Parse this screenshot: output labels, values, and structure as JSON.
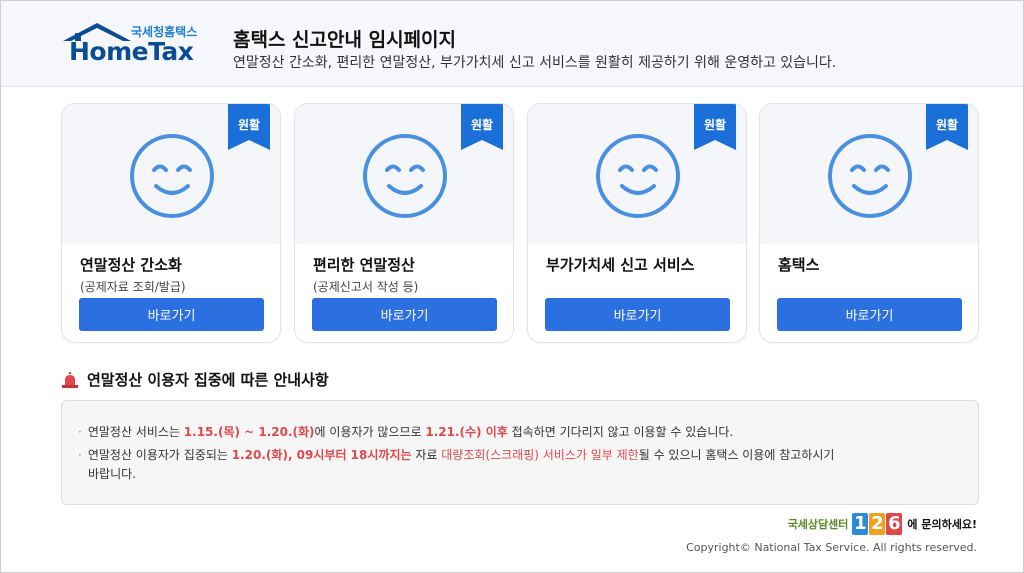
{
  "header": {
    "logo_sub": "국세청홈택스",
    "logo_main": "HomeTax",
    "title": "홈택스 신고안내 임시페이지",
    "subtitle": "연말정산 간소화, 편리한 연말정산, 부가가치세 신고 서비스를 원활히 제공하기 위해 운영하고 있습니다."
  },
  "cards": [
    {
      "status": "원활",
      "title": "연말정산 간소화",
      "desc": "(공제자료 조회/발급)",
      "button": "바로가기"
    },
    {
      "status": "원활",
      "title": "편리한 연말정산",
      "desc": "(공제신고서 작성 등)",
      "button": "바로가기"
    },
    {
      "status": "원활",
      "title": "부가가치세 신고 서비스",
      "desc": "",
      "button": "바로가기"
    },
    {
      "status": "원활",
      "title": "홈택스",
      "desc": "",
      "button": "바로가기"
    }
  ],
  "notice": {
    "title": "연말정산 이용자 집중에 따른 안내사항",
    "line1": {
      "a": "연말정산 서비스는 ",
      "b": "1.15.(목) ~ 1.20.(화)",
      "c": "에 이용자가 많으므로 ",
      "d": "1.21.(수) 이후",
      "e": " 접속하면 기다리지 않고 이용할 수 있습니다."
    },
    "line2": {
      "a": "연말정산 이용자가 집중되는 ",
      "b": "1.20.(화), 09시부터 18시까지는",
      "c": " 자료 ",
      "d": "대량조회(스크래핑) 서비스가 일부 제한",
      "e": "될 수 있으니 홈택스 이용에 참고하시기",
      "f": "바랍니다."
    }
  },
  "footer": {
    "call_sub": "국세상담센터",
    "call_digits": [
      "1",
      "2",
      "6"
    ],
    "call_tail": "에 문의하세요!",
    "copyright": "Copyright© National Tax Service. All rights reserved."
  },
  "colors": {
    "accent": "#2c6fe0",
    "ribbon": "#1b6fd8",
    "smiley": "#4a90e2",
    "highlight": "#e0484c"
  }
}
